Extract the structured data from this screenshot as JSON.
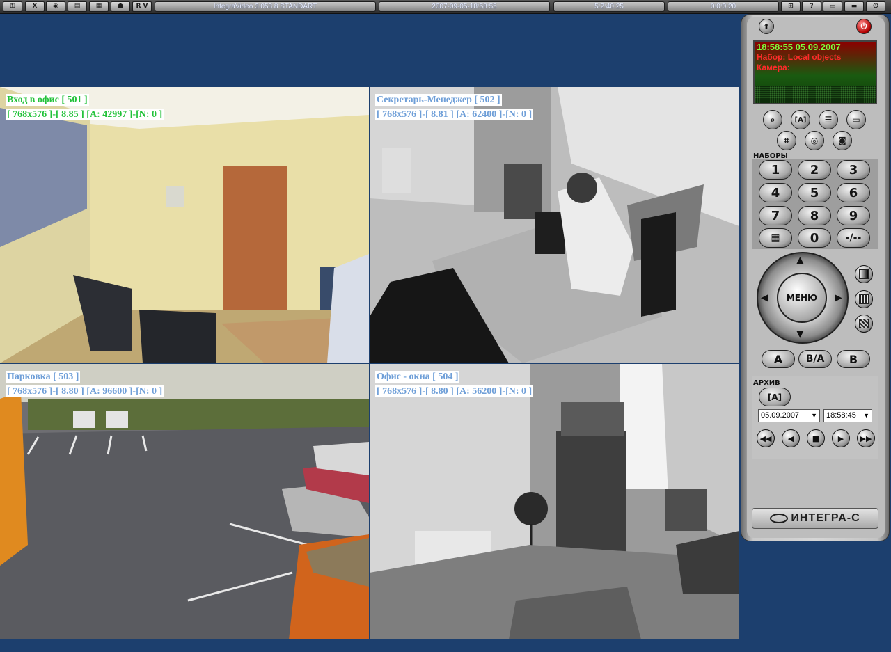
{
  "topbar": {
    "icons": [
      "key-icon",
      "xy-icon",
      "eye-icon",
      "monitor-icon",
      "grid-icon",
      "person-icon",
      "rv-icon"
    ],
    "icon_labels": [
      "",
      "X",
      "",
      "",
      "",
      "",
      "R V"
    ],
    "app_title": "IntegraVideo 3.053.8 STANDART",
    "datetime": "2007-09-05-18:58:55",
    "uptime": "5:2:40:25",
    "counter": "0:0:0:20",
    "right_icons": [
      "network-icon",
      "help-icon",
      "window-icon",
      "layout-icon",
      "power-icon"
    ],
    "right_labels": [
      "",
      "?",
      "",
      "",
      ""
    ]
  },
  "cameras": [
    {
      "title": "Вход в офис [ 501 ]",
      "info": "[ 768x576 ]-[ 8.85 ] [A: 42997 ]-[N: 0 ]"
    },
    {
      "title": "Секретарь-Менеджер [ 502 ]",
      "info": "[ 768x576 ]-[ 8.81 ] [A: 62400 ]-[N: 0 ]"
    },
    {
      "title": "Парковка [ 503 ]",
      "info": "[ 768x576 ]-[ 8.80 ] [A: 96600 ]-[N: 0 ]"
    },
    {
      "title": "Офис - окна [ 504 ]",
      "info": "[ 768x576 ]-[ 8.80 ] [A: 56200 ]-[N: 0 ]"
    }
  ],
  "panel": {
    "display_time": "18:58:55 05.09.2007",
    "display_set": "Набор: Local objects",
    "display_camera": "Камера:",
    "sets_title": "НАБОРЫ",
    "digits": [
      "1",
      "2",
      "3",
      "4",
      "5",
      "6",
      "7",
      "8",
      "9",
      "",
      "0",
      "-/--"
    ],
    "menu_label": "МЕНЮ",
    "btn_a": "A",
    "btn_ba": "B/A",
    "btn_b": "B",
    "archive_title": "АРХИВ",
    "archive_date": "05.09.2007",
    "archive_time": "18:58:45",
    "logo": "ИНТЕГРА-С"
  },
  "colors": {
    "background": "#1c3f6e",
    "label_green": "#22c23a",
    "label_blue": "#6f9fd8",
    "display_time": "#7dff3c",
    "display_red": "#ff2a2a"
  }
}
